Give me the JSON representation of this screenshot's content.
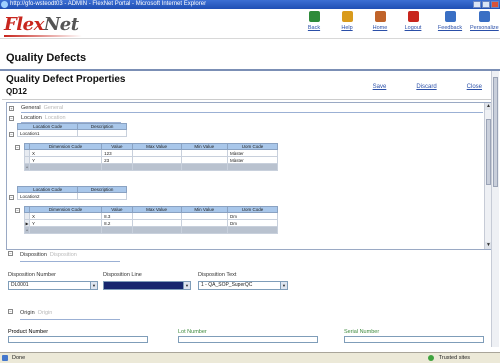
{
  "window": {
    "title": "http://gfo-wsteodt03 - ADMIN - FlexNet Portal - Microsoft Internet Explorer"
  },
  "brand": {
    "logo_primary": "Flex",
    "logo_secondary": "Net"
  },
  "header_nav": [
    {
      "label": "Back",
      "icon": "back-icon",
      "color": "#2e8b3a"
    },
    {
      "label": "Help",
      "icon": "help-icon",
      "color": "#d99b1c"
    },
    {
      "label": "Home",
      "icon": "home-icon",
      "color": "#c0632a"
    },
    {
      "label": "Logout",
      "icon": "logout-icon",
      "color": "#c8261e"
    },
    {
      "label": "Feedback",
      "icon": "feedback-icon",
      "color": "#3a6fc4"
    },
    {
      "label": "Personalize",
      "icon": "personalize-icon",
      "color": "#3a6fc4"
    }
  ],
  "page": {
    "title": "Quality Defects"
  },
  "properties": {
    "title": "Quality Defect Properties",
    "code": "QD12",
    "actions": {
      "save": "Save",
      "discard": "Discard",
      "close": "Close"
    }
  },
  "sections": {
    "general": {
      "label": "General",
      "ghost": "General"
    },
    "location": {
      "label": "Location",
      "ghost": "Location"
    },
    "disposition": {
      "label": "Disposition",
      "ghost": "Disposition"
    },
    "origin": {
      "label": "Origin",
      "ghost": "Origin"
    }
  },
  "locations": [
    {
      "header": {
        "code_col": "Location Code",
        "desc_col": "Description"
      },
      "code": "Location1",
      "description": "",
      "dimensions": {
        "columns": [
          "Dimension Code",
          "Value",
          "Max Value",
          "Min Value",
          "Uom Code"
        ],
        "rows": [
          [
            "X",
            "123",
            "",
            "",
            "Màster"
          ],
          [
            "Y",
            "23",
            "",
            "",
            "Màster"
          ]
        ]
      }
    },
    {
      "header": {
        "code_col": "Location Code",
        "desc_col": "Description"
      },
      "code": "Location2",
      "description": "",
      "dimensions": {
        "columns": [
          "Dimension Code",
          "Value",
          "Max Value",
          "Min Value",
          "Uom Code"
        ],
        "rows": [
          [
            "X",
            "8.3",
            "",
            "",
            "Dm"
          ],
          [
            "Y",
            "8.2",
            "",
            "",
            "Dm"
          ]
        ]
      }
    }
  ],
  "disposition": {
    "number_label": "Disposition Number",
    "number_value": "DL0001",
    "line_label": "Disposition Line",
    "line_value": "",
    "text_label": "Disposition Text",
    "text_value": "1 - QA_SOP_SuperQC"
  },
  "origin": {
    "product_label": "Product Number",
    "lot_label": "Lot Number",
    "serial_label": "Serial Number"
  },
  "status": {
    "left": "Done",
    "right": "Trusted sites"
  }
}
